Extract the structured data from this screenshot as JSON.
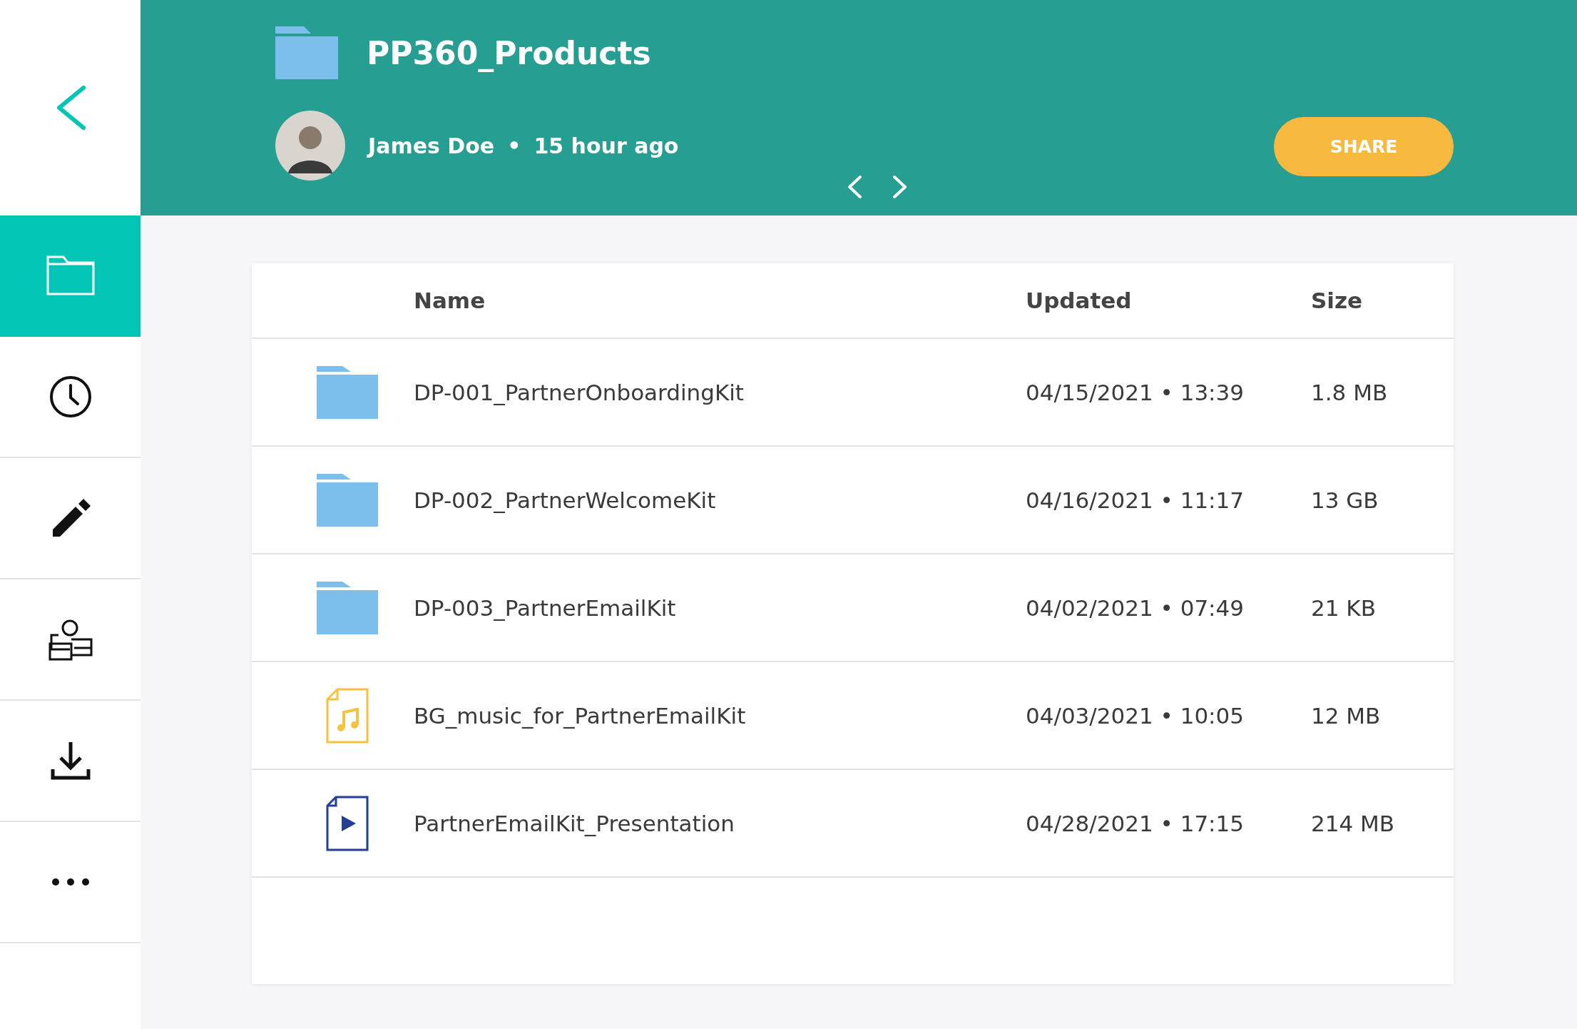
{
  "sidebar": {
    "items": [
      {
        "kind": "folder",
        "selected": true
      },
      {
        "kind": "clock",
        "selected": false
      },
      {
        "kind": "pencil",
        "selected": false
      },
      {
        "kind": "people",
        "selected": false
      },
      {
        "kind": "download",
        "selected": false
      },
      {
        "kind": "more",
        "selected": false
      }
    ]
  },
  "header": {
    "title": "PP360_Products",
    "owner": "James Doe",
    "separator": "•",
    "time": "15 hour ago",
    "share_button": "SHARE"
  },
  "table": {
    "columns": [
      "Name",
      "Updated",
      "Size"
    ],
    "rows": [
      {
        "kind": "folder",
        "name": "DP-001_PartnerOnboardingKit",
        "updated": "04/15/2021 • 13:39",
        "size": "1.8 MB"
      },
      {
        "kind": "folder",
        "name": "DP-002_PartnerWelcomeKit",
        "updated": "04/16/2021 • 11:17",
        "size": "13 GB"
      },
      {
        "kind": "folder",
        "name": "DP-003_PartnerEmailKit",
        "updated": "04/02/2021 • 07:49",
        "size": "21 KB"
      },
      {
        "kind": "audio",
        "name": "BG_music_for_PartnerEmailKit",
        "updated": "04/03/2021 • 10:05",
        "size": "12 MB"
      },
      {
        "kind": "video",
        "name": "PartnerEmailKit_Presentation",
        "updated": "04/28/2021 • 17:15",
        "size": "214 MB"
      }
    ]
  }
}
